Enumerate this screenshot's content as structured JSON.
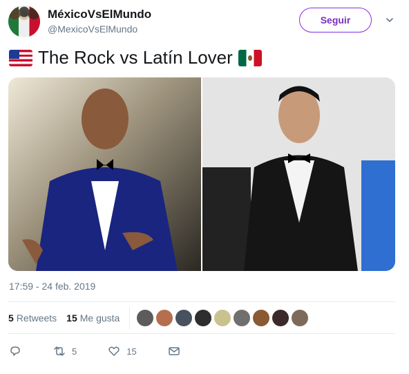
{
  "user": {
    "name": "MéxicoVsElMundo",
    "handle": "@MexicoVsElMundo",
    "follow_label": "Seguir"
  },
  "tweet": {
    "text": "The Rock vs Latín Lover",
    "lead_flag": "us-flag-icon",
    "trail_flag": "mexico-flag-icon",
    "timestamp": "17:59 - 24 feb. 2019"
  },
  "stats": {
    "retweets_count": "5",
    "retweets_label": "Retweets",
    "likes_count": "15",
    "likes_label": "Me gusta",
    "liker_avatars": 9
  },
  "actions": {
    "reply_icon": "reply-icon",
    "retweet_count": "5",
    "like_count": "15",
    "dm_icon": "mail-icon"
  },
  "colors": {
    "follow_accent": "#7b2cbf",
    "secondary_text": "#657786",
    "primary_text": "#14171a",
    "divider": "#e6ecf0"
  }
}
